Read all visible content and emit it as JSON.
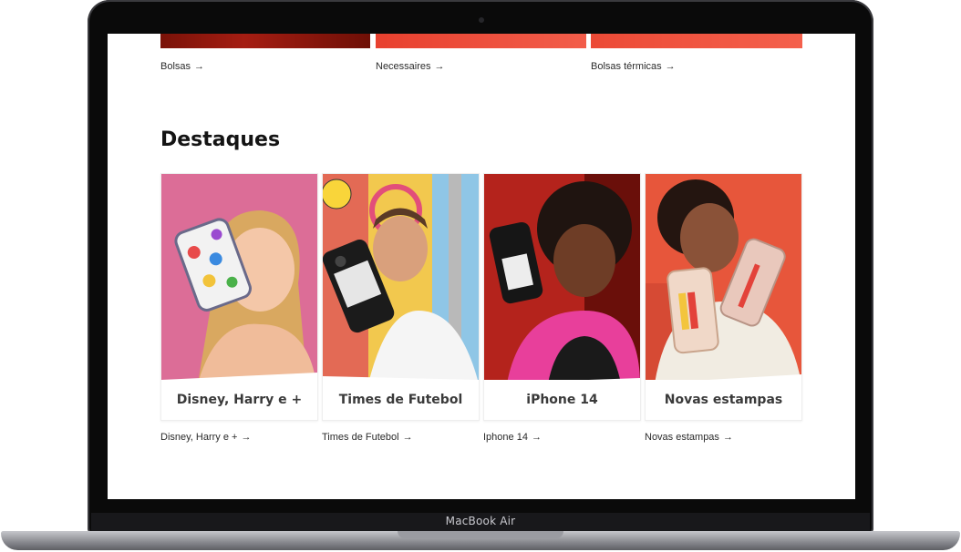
{
  "device": {
    "brand": "MacBook Air"
  },
  "categories": [
    {
      "label": "Bolsas",
      "arrow": "→",
      "color": "#8e1a10"
    },
    {
      "label": "Necessaires",
      "arrow": "→",
      "color": "#f04a3c"
    },
    {
      "label": "Bolsas térmicas",
      "arrow": "→",
      "color": "#f0523f"
    }
  ],
  "highlights": {
    "title": "Destaques",
    "cards": [
      {
        "caption": "Disney, Harry e +",
        "link": "Disney, Harry e +",
        "arrow": "→",
        "bg": "#dd6a96"
      },
      {
        "caption": "Times de Futebol",
        "link": "Times de Futebol",
        "arrow": "→",
        "bg": "#f0c04a"
      },
      {
        "caption": "iPhone 14",
        "link": "Iphone 14",
        "arrow": "→",
        "bg": "#b3221c"
      },
      {
        "caption": "Novas estampas",
        "link": "Novas estampas",
        "arrow": "→",
        "bg": "#e8513a"
      }
    ]
  }
}
